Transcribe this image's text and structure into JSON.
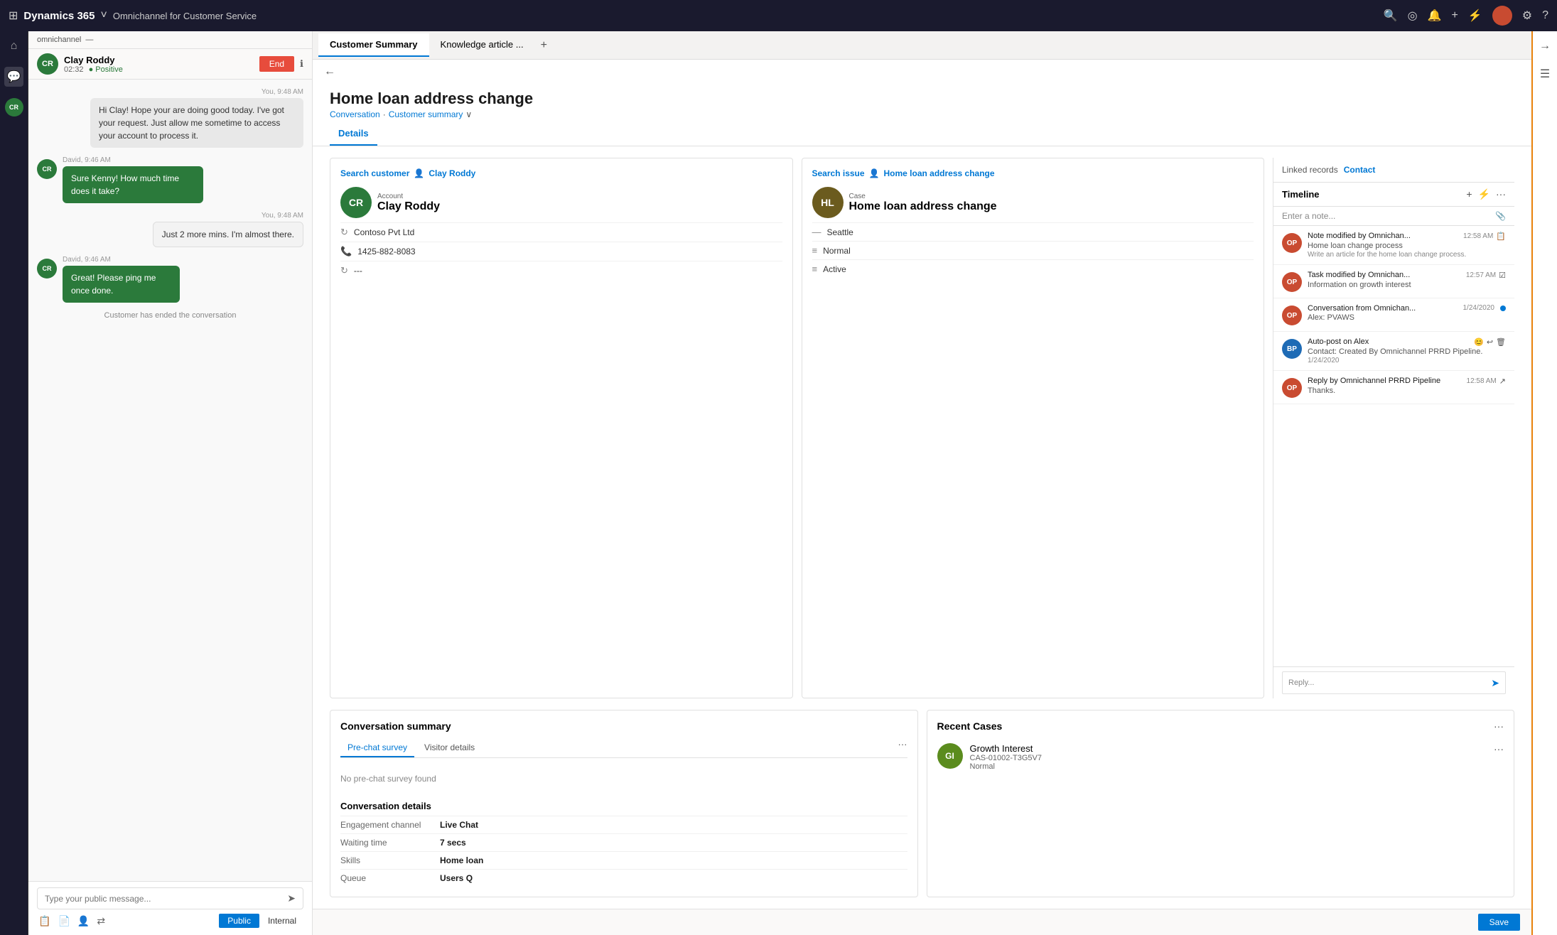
{
  "topNav": {
    "appGrid": "⊞",
    "appName": "Dynamics 365",
    "chevron": "∨",
    "moduleName": "Omnichannel for Customer Service",
    "searchIcon": "🔍",
    "browseIcon": "◎",
    "bellIcon": "🔔",
    "addIcon": "+",
    "filterIcon": "⚡",
    "userAvatar": "●",
    "settingsIcon": "⚙",
    "helpIcon": "?"
  },
  "leftSidebar": {
    "homeIcon": "⌂",
    "chatIcon": "💬",
    "crBadge": "CR"
  },
  "chatPanel": {
    "searchLabel": "omnichannel",
    "collapseIcon": "—",
    "customerName": "Clay Roddy",
    "chatTime": "02:32",
    "sentiment": "Positive",
    "endButton": "End",
    "infoIcon": "ℹ",
    "crBadge": "CR",
    "messages": [
      {
        "type": "agent",
        "time": "You, 9:48 AM",
        "text": "Hi Clay! Hope your are doing good today. I've got your request. Just allow me sometime to access your account to process it."
      },
      {
        "type": "customer",
        "time": "David, 9:46 AM",
        "text": "Sure Kenny! How much time does it take?"
      },
      {
        "type": "agent",
        "time": "You, 9:48 AM",
        "text": "Just 2 more mins. I'm almost there."
      },
      {
        "type": "customer",
        "time": "David, 9:46 AM",
        "text": "Great! Please ping me once done."
      },
      {
        "type": "system",
        "text": "Customer has ended the conversation"
      }
    ],
    "inputPlaceholder": "Type your public message...",
    "sendIcon": "➤",
    "tools": [
      "📋",
      "📄",
      "👤",
      "⇄"
    ],
    "publicBtn": "Public",
    "internalBtn": "Internal"
  },
  "tabs": [
    {
      "label": "Customer Summary",
      "active": true
    },
    {
      "label": "Knowledge article ...",
      "active": false
    }
  ],
  "addTabIcon": "+",
  "pageHeader": {
    "backIcon": "←",
    "title": "Home loan address change",
    "breadcrumb1": "Conversation",
    "separator": "·",
    "breadcrumb2": "Customer summary",
    "chevron": "∨"
  },
  "subTabs": [
    {
      "label": "Details",
      "active": true
    }
  ],
  "customerCard": {
    "searchLabel": "Search customer",
    "personIcon": "👤",
    "customerName": "Clay Roddy",
    "avatarInitials": "CR",
    "avatarBg": "#2b7a3b",
    "accountLabel": "Account",
    "company": "Contoso Pvt Ltd",
    "phone": "1425-882-8083",
    "extra": "---",
    "companyIcon": "↻",
    "phoneIcon": "📞",
    "extraIcon": "↻"
  },
  "caseCard": {
    "searchLabel": "Search issue",
    "personIcon": "👤",
    "caseTitle": "Home loan address change",
    "avatarInitials": "HL",
    "avatarBg": "#6b5b1e",
    "caseLabel": "Case",
    "location": "Seattle",
    "priority": "Normal",
    "status": "Active",
    "locationIcon": "—",
    "priorityIcon": "≡",
    "statusIcon": "≡"
  },
  "conversationSummary": {
    "title": "Conversation summary",
    "tabs": [
      {
        "label": "Pre-chat survey",
        "active": true
      },
      {
        "label": "Visitor details",
        "active": false
      }
    ],
    "overflowIcon": "···",
    "noSurveyText": "No pre-chat survey found",
    "detailsTitle": "Conversation details",
    "details": [
      {
        "label": "Engagement channel",
        "value": "Live Chat"
      },
      {
        "label": "Waiting time",
        "value": "7 secs"
      },
      {
        "label": "Skills",
        "value": "Home loan"
      },
      {
        "label": "Queue",
        "value": "Users Q"
      }
    ]
  },
  "recentCases": {
    "title": "Recent Cases",
    "overflowIcon": "···",
    "cases": [
      {
        "initials": "GI",
        "avatarBg": "#5b8c1e",
        "title": "Growth Interest",
        "id": "CAS-01002-T3G5V7",
        "priority": "Normal",
        "overflowIcon": "···"
      }
    ]
  },
  "rightPanel": {
    "linkedRecordsLabel": "Linked records",
    "contactLabel": "Contact",
    "timelineTitle": "Timeline",
    "addIcon": "+",
    "filterIcon": "⚡",
    "moreIcon": "···",
    "notePlaceholder": "Enter a note...",
    "attachIcon": "📎",
    "sendIcon": "➤",
    "items": [
      {
        "avatarInitials": "OP",
        "avatarBg": "#c94b31",
        "title": "Note modified by Omnichan...",
        "time": "12:58 AM",
        "subtitle": "Home loan change process",
        "detail": "Write an article for the home loan change process.",
        "actionIcon": "📋",
        "hasAction": true
      },
      {
        "avatarInitials": "OP",
        "avatarBg": "#c94b31",
        "title": "Task modified by Omnichan...",
        "time": "12:57 AM",
        "subtitle": "Information on growth interest",
        "detail": "",
        "actionIcon": "☑",
        "hasAction": true
      },
      {
        "avatarInitials": "OP",
        "avatarBg": "#c94b31",
        "title": "Conversation from Omnichan...",
        "time": "1/24/2020",
        "subtitle": "Alex: PVAWS",
        "detail": "",
        "statusDot": true,
        "hasAction": false
      },
      {
        "avatarInitials": "BP",
        "avatarBg": "#1e6bb5",
        "title": "Auto-post on Alex",
        "time": "",
        "subtitle": "Contact: Created By Omnichannel PRRD Pipeline.",
        "detail": "1/24/2020",
        "hasAction": false,
        "emojiIcon": "😊",
        "replyIcon": "↩",
        "deleteIcon": "🗑"
      },
      {
        "avatarInitials": "OP",
        "avatarBg": "#c94b31",
        "title": "Reply by Omnichannel PRRD Pipeline",
        "time": "12:58 AM",
        "subtitle": "Thanks.",
        "detail": "",
        "hasAction": true,
        "shareIcon": "↗"
      }
    ],
    "replyPlaceholder": "Reply...",
    "sendBtnIcon": "➤"
  },
  "farRight": {
    "expandIcon": "→",
    "listIcon": "☰"
  },
  "saveBar": {
    "saveLabel": "Save"
  }
}
